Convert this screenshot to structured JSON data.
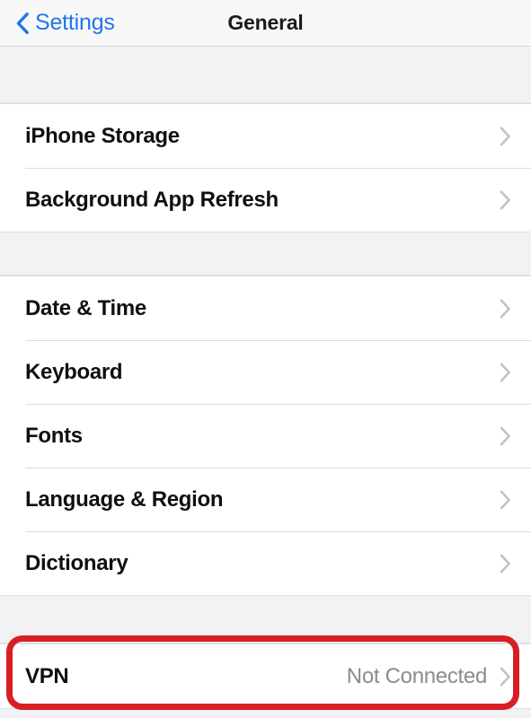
{
  "navbar": {
    "back_label": "Settings",
    "back_icon": "chevron-left-icon",
    "title": "General",
    "tint_color": "#2176e8"
  },
  "sections": [
    {
      "name": "storage-section",
      "rows": [
        {
          "label": "iPhone Storage",
          "value": "",
          "accessory": "chevron-right-icon"
        },
        {
          "label": "Background App Refresh",
          "value": "",
          "accessory": "chevron-right-icon"
        }
      ]
    },
    {
      "name": "localization-section",
      "rows": [
        {
          "label": "Date & Time",
          "value": "",
          "accessory": "chevron-right-icon"
        },
        {
          "label": "Keyboard",
          "value": "",
          "accessory": "chevron-right-icon"
        },
        {
          "label": "Fonts",
          "value": "",
          "accessory": "chevron-right-icon"
        },
        {
          "label": "Language & Region",
          "value": "",
          "accessory": "chevron-right-icon"
        },
        {
          "label": "Dictionary",
          "value": "",
          "accessory": "chevron-right-icon"
        }
      ]
    },
    {
      "name": "vpn-section",
      "rows": [
        {
          "label": "VPN",
          "value": "Not Connected",
          "accessory": "chevron-right-icon"
        }
      ]
    }
  ],
  "annotation": {
    "target": "VPN",
    "shape": "rounded-rectangle",
    "color": "#d81f26"
  }
}
